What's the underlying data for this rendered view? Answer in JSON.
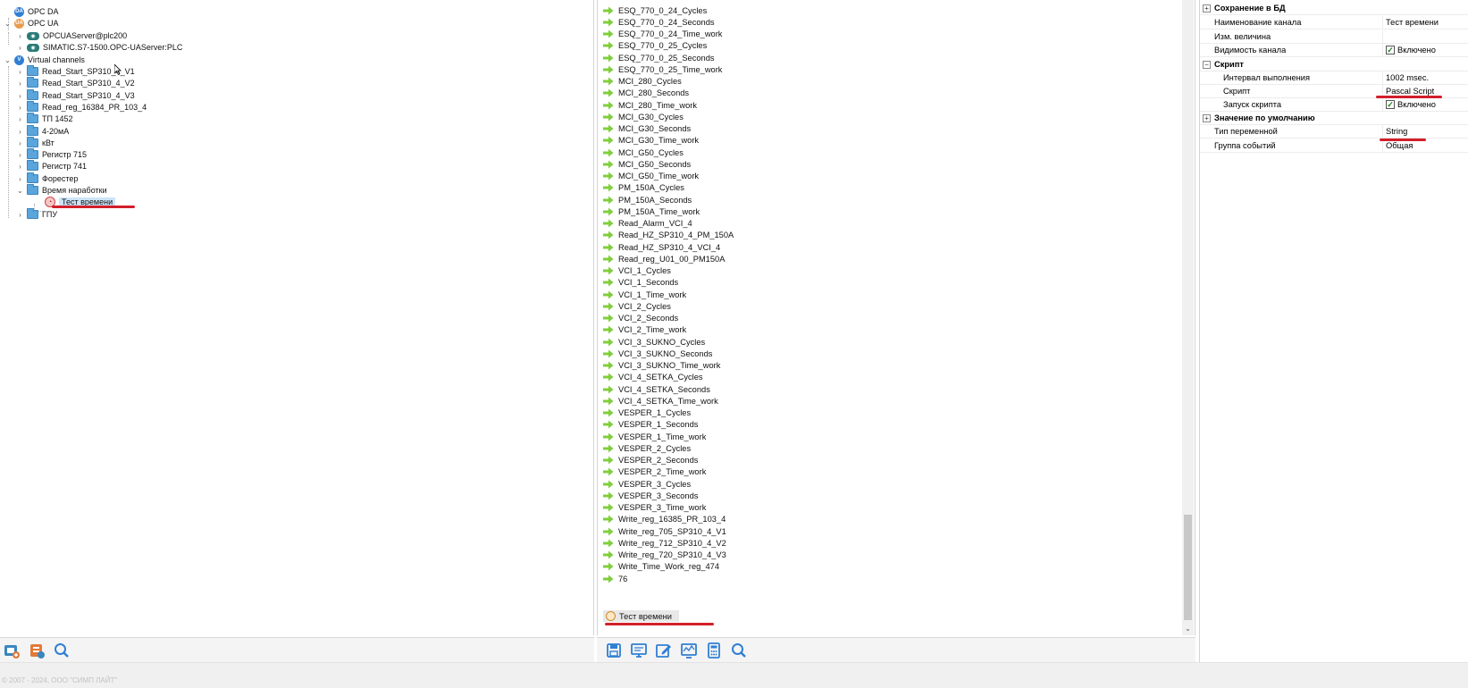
{
  "tree": {
    "nodes": [
      {
        "label": "OPC DA",
        "icon": "opc-da-icon"
      },
      {
        "label": "OPC UA",
        "icon": "opc-ua-icon"
      },
      {
        "label": "OPCUAServer@plc200",
        "icon": "server-icon"
      },
      {
        "label": "SIMATIC.S7-1500.OPC-UAServer:PLC",
        "icon": "server-icon"
      },
      {
        "label": "Virtual channels",
        "icon": "virtual-channels-icon"
      },
      {
        "label": "Read_Start_SP310_4_V1",
        "icon": "folder-icon"
      },
      {
        "label": "Read_Start_SP310_4_V2",
        "icon": "folder-icon"
      },
      {
        "label": "Read_Start_SP310_4_V3",
        "icon": "folder-icon"
      },
      {
        "label": "Read_reg_16384_PR_103_4",
        "icon": "folder-icon"
      },
      {
        "label": "ТП 1452",
        "icon": "folder-icon"
      },
      {
        "label": "4-20мА",
        "icon": "folder-icon"
      },
      {
        "label": "кВт",
        "icon": "folder-icon"
      },
      {
        "label": "Регистр 715",
        "icon": "folder-icon"
      },
      {
        "label": "Регистр 741",
        "icon": "folder-icon"
      },
      {
        "label": "Форестер",
        "icon": "folder-icon"
      },
      {
        "label": "Время наработки",
        "icon": "folder-icon"
      },
      {
        "label": "Тест времени",
        "icon": "script-icon"
      },
      {
        "label": "ГПУ",
        "icon": "folder-icon"
      }
    ]
  },
  "channels": {
    "items": [
      "ESQ_770_0_24_Cycles",
      "ESQ_770_0_24_Seconds",
      "ESQ_770_0_24_Time_work",
      "ESQ_770_0_25_Cycles",
      "ESQ_770_0_25_Seconds",
      "ESQ_770_0_25_Time_work",
      "MCI_280_Cycles",
      "MCI_280_Seconds",
      "MCI_280_Time_work",
      "MCI_G30_Cycles",
      "MCI_G30_Seconds",
      "MCI_G30_Time_work",
      "MCI_G50_Cycles",
      "MCI_G50_Seconds",
      "MCI_G50_Time_work",
      "PM_150A_Cycles",
      "PM_150A_Seconds",
      "PM_150A_Time_work",
      "Read_Alarm_VCI_4",
      "Read_HZ_SP310_4_PM_150A",
      "Read_HZ_SP310_4_VCI_4",
      "Read_reg_U01_00_PM150A",
      "VCI_1_Cycles",
      "VCI_1_Seconds",
      "VCI_1_Time_work",
      "VCI_2_Cycles",
      "VCI_2_Seconds",
      "VCI_2_Time_work",
      "VCI_3_SUKNO_Cycles",
      "VCI_3_SUKNO_Seconds",
      "VCI_3_SUKNO_Time_work",
      "VCI_4_SETKA_Cycles",
      "VCI_4_SETKA_Seconds",
      "VCI_4_SETKA_Time_work",
      "VESPER_1_Cycles",
      "VESPER_1_Seconds",
      "VESPER_1_Time_work",
      "VESPER_2_Cycles",
      "VESPER_2_Seconds",
      "VESPER_2_Time_work",
      "VESPER_3_Cycles",
      "VESPER_3_Seconds",
      "VESPER_3_Time_work",
      "Write_reg_16385_PR_103_4",
      "Write_reg_705_SP310_4_V1",
      "Write_reg_712_SP310_4_V2",
      "Write_reg_720_SP310_4_V3",
      "Write_Time_Work_reg_474",
      "76"
    ],
    "selected": "Тест времени"
  },
  "properties": {
    "cat_db": "Сохранение в БД",
    "channel_name_label": "Наименование канала",
    "channel_name_value": "Тест времени",
    "unit_label": "Изм. величина",
    "unit_value": "",
    "visibility_label": "Видимость канала",
    "visibility_value": "Включено",
    "cat_script": "Скрипт",
    "interval_label": "Интервал выполнения",
    "interval_value": "1002 msec.",
    "script_label": "Скрипт",
    "script_value": "Pascal Script",
    "script_run_label": "Запуск скрипта",
    "script_run_value": "Включено",
    "cat_default": "Значение по умолчанию",
    "var_type_label": "Тип переменной",
    "var_type_value": "String",
    "event_group_label": "Группа событий",
    "event_group_value": "Общая"
  },
  "toolbars": {
    "left": [
      "add-channel-icon",
      "add-script-icon",
      "search-icon"
    ],
    "middle": [
      "save-icon",
      "monitor-icon",
      "edit-icon",
      "chart-icon",
      "calculator-icon",
      "search-icon"
    ]
  },
  "status": {
    "copyright": "© 2007 - 2024, ООО \"СИМП ЛАЙТ\""
  },
  "colors": {
    "accent_arrow": "#7fce3c",
    "annotation_red": "#d21f2a",
    "folder_blue": "#5aa5dc",
    "selection_bg": "#cde4f7"
  }
}
